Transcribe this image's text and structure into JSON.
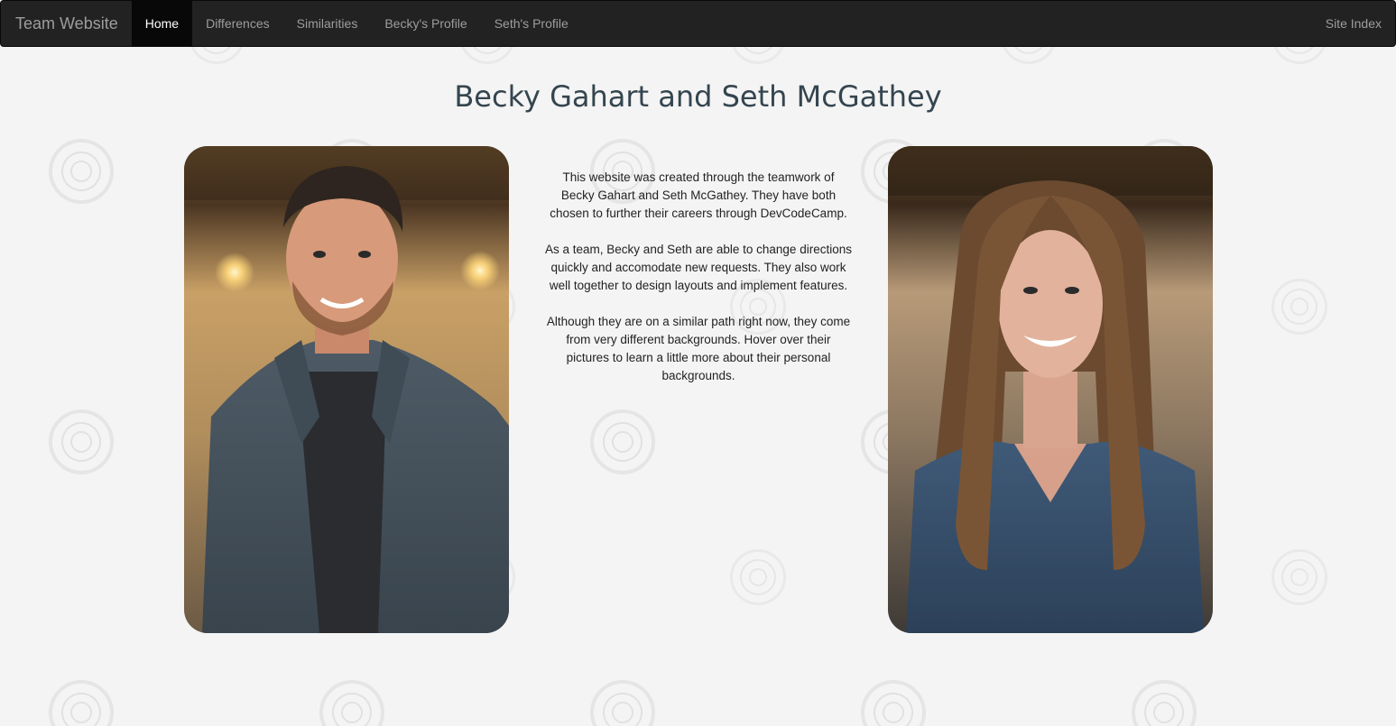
{
  "nav": {
    "brand": "Team Website",
    "items": [
      {
        "label": "Home",
        "active": true
      },
      {
        "label": "Differences",
        "active": false
      },
      {
        "label": "Similarities",
        "active": false
      },
      {
        "label": "Becky's Profile",
        "active": false
      },
      {
        "label": "Seth's Profile",
        "active": false
      }
    ],
    "right_link": "Site Index"
  },
  "page": {
    "title": "Becky Gahart and Seth McGathey"
  },
  "intro": {
    "paragraphs": [
      "This website was created through the teamwork of Becky Gahart and Seth McGathey. They have both chosen to further their careers through DevCodeCamp.",
      "As a team, Becky and Seth are able to change directions quickly and accomodate new requests. They also work well together to design layouts and implement features.",
      "Although they are on a similar path right now, they come from very different backgrounds. Hover over their pictures to learn a little more about their personal backgrounds."
    ]
  },
  "colors": {
    "navbar_bg": "#222222",
    "nav_active_bg": "#080808",
    "nav_text": "#9d9d9d",
    "title": "#34454f",
    "page_bg": "#f4f4f4"
  }
}
